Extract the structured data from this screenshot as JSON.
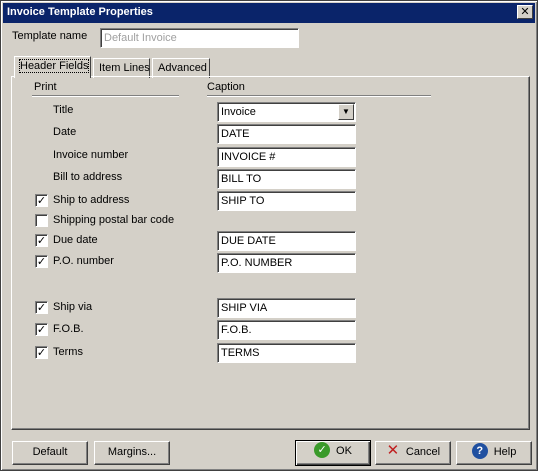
{
  "window": {
    "title": "Invoice Template Properties",
    "close_glyph": "✕"
  },
  "template_name": {
    "label": "Template name",
    "value": "Default Invoice"
  },
  "tabs": [
    {
      "label": "Header Fields",
      "active": true
    },
    {
      "label": "Item Lines",
      "active": false
    },
    {
      "label": "Advanced",
      "active": false
    }
  ],
  "columns": {
    "print": "Print",
    "caption": "Caption"
  },
  "fields": {
    "title": {
      "label": "Title",
      "checked": false,
      "caption": "Invoice"
    },
    "date": {
      "label": "Date",
      "checked": false,
      "caption": "DATE"
    },
    "invoice_number": {
      "label": "Invoice number",
      "checked": false,
      "caption": "INVOICE #"
    },
    "bill_to": {
      "label": "Bill to address",
      "checked": false,
      "caption": "BILL TO"
    },
    "ship_to": {
      "label": "Ship to address",
      "checked": true,
      "caption": "SHIP TO"
    },
    "postal_bar": {
      "label": "Shipping postal bar code",
      "checked": false
    },
    "due_date": {
      "label": "Due date",
      "checked": true,
      "caption": "DUE DATE"
    },
    "po_number": {
      "label": "P.O. number",
      "checked": true,
      "caption": "P.O. NUMBER"
    },
    "ship_via": {
      "label": "Ship via",
      "checked": true,
      "caption": "SHIP VIA"
    },
    "fob": {
      "label": "F.O.B.",
      "checked": true,
      "caption": "F.O.B."
    },
    "terms": {
      "label": "Terms",
      "checked": true,
      "caption": "TERMS"
    }
  },
  "check_glyph": "✓",
  "buttons": {
    "default": "Default",
    "margins": "Margins...",
    "ok": "OK",
    "cancel": "Cancel",
    "help": "Help"
  },
  "icons": {
    "ok": "ok-check-icon",
    "cancel": "cancel-x-icon",
    "help": "help-question-icon"
  },
  "colors": {
    "titlebar": "#0a246a",
    "face": "#d4d0c8",
    "ok_icon": "#3a9a2a",
    "cancel_icon": "#c02020",
    "help_icon": "#2050a0"
  }
}
